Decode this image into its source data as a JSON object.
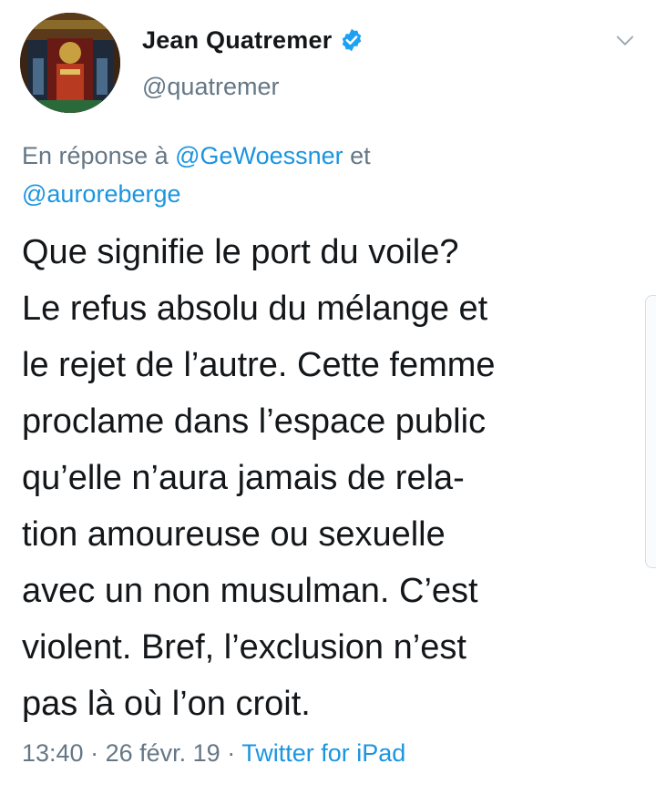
{
  "author": {
    "display_name": "Jean Quatremer",
    "handle": "@quatremer",
    "verified": true
  },
  "reply_context": {
    "prefix": "En réponse à",
    "mention_1": "@GeWoessner",
    "conjunction": "et",
    "mention_2": "@auroreberge"
  },
  "tweet": {
    "lines": [
      "Que signifie le port du voile?",
      "Le refus absolu du mélange et",
      "le rejet de l’autre. Cette femme",
      "proclame dans l’espace public",
      "qu’elle n’aura jamais de rela-",
      "tion amoureuse ou sexuelle",
      "avec un non musulman. C’est",
      "violent. Bref, l’exclusion n’est",
      "pas là où l’on croit."
    ]
  },
  "meta": {
    "time": "13:40",
    "separator": "·",
    "date": "26 févr. 19",
    "source": "Twitter for iPad"
  },
  "colors": {
    "link": "#1b95e0",
    "secondary_text": "#657786",
    "primary_text": "#14171a",
    "verified_badge": "#1da1f2"
  },
  "icons": {
    "verified": "verified-badge-icon",
    "more": "chevron-down-icon"
  }
}
